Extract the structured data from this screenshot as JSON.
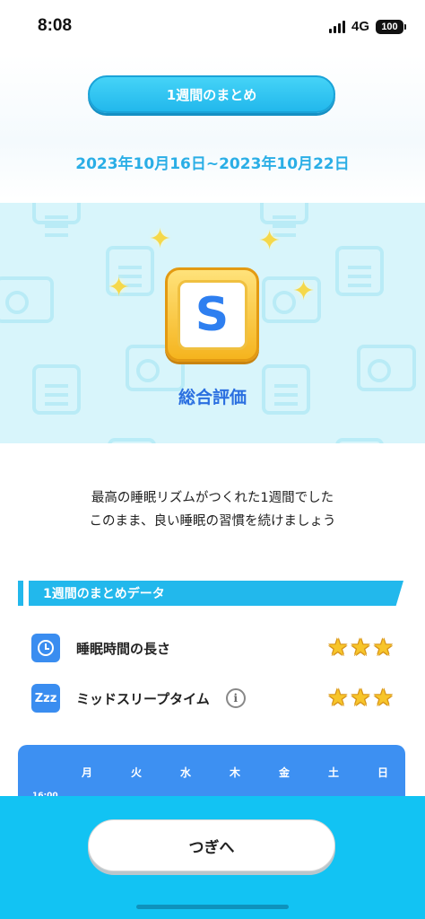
{
  "status_bar": {
    "time": "8:08",
    "network": "4G",
    "battery": "100"
  },
  "header": {
    "title": "1週間のまとめ",
    "date_range": "2023年10月16日~2023年10月22日"
  },
  "rank": {
    "letter": "S",
    "label": "総合評価"
  },
  "message": {
    "line1": "最高の睡眠リズムがつくれた1週間でした",
    "line2": "このまま、良い睡眠の習慣を続けましょう"
  },
  "summary": {
    "section_title": "1週間のまとめデータ",
    "items": [
      {
        "label": "睡眠時間の長さ",
        "icon": "clock-icon",
        "stars": 3
      },
      {
        "label": "ミッドスリープタイム",
        "icon": "zzz-icon",
        "icon_text": "Zzz",
        "stars": 3,
        "info": "i"
      }
    ]
  },
  "chart": {
    "days": [
      "月",
      "火",
      "水",
      "木",
      "金",
      "土",
      "日"
    ],
    "time_tick": "16:00"
  },
  "footer": {
    "next_label": "つぎへ"
  },
  "colors": {
    "accent": "#22b8ec",
    "rank_text": "#2a6fe0",
    "chart_bg": "#3d90f2",
    "footer_bg": "#12c3f3",
    "star": "#f7c52a"
  }
}
